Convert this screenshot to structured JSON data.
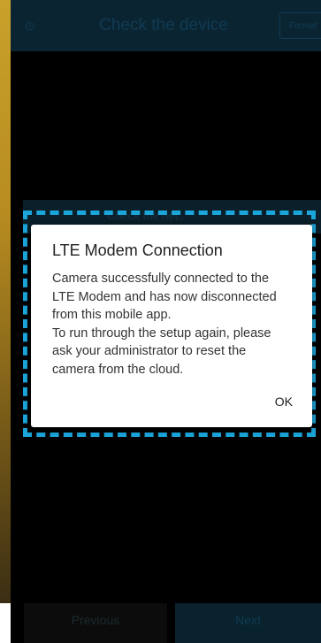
{
  "header": {
    "title": "Check the device",
    "back_icon": "circle-back-icon",
    "format_label": "Format"
  },
  "background": {
    "bar_label": "Check the net..."
  },
  "dialog": {
    "title": "LTE Modem Connection",
    "body_lines": [
      "Camera successfully connected to the",
      "LTE Modem and has now disconnected",
      "from this mobile app.",
      "To run through the setup again, please",
      "ask your administrator to reset the",
      "camera from the cloud."
    ],
    "ok_label": "OK"
  },
  "footer": {
    "previous_label": "Previous",
    "next_label": "Next"
  },
  "colors": {
    "highlight": "#1ba6db",
    "header_bg": "#0b2432",
    "gold_edge": "#c9a12a"
  }
}
